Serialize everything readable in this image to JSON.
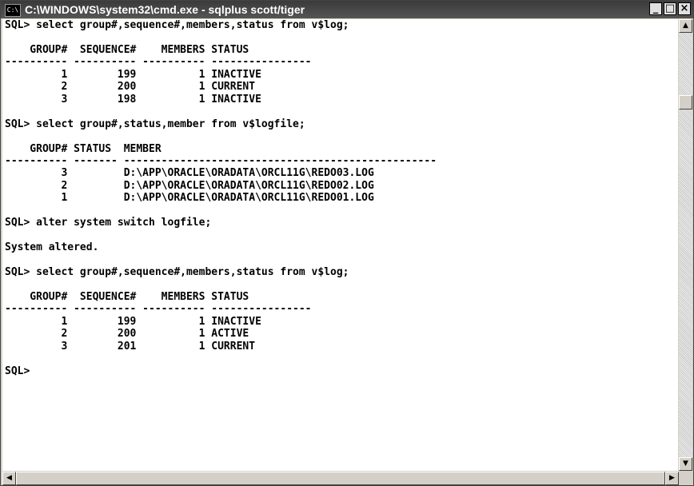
{
  "window": {
    "title": "C:\\WINDOWS\\system32\\cmd.exe - sqlplus scott/tiger",
    "icon": "cmd-icon",
    "buttons": {
      "minimize": "_",
      "maximize": "□",
      "close": "×"
    }
  },
  "console": {
    "lines": [
      "SQL> select group#,sequence#,members,status from v$log;",
      "",
      "    GROUP#  SEQUENCE#    MEMBERS STATUS",
      "---------- ---------- ---------- ----------------",
      "         1        199          1 INACTIVE",
      "         2        200          1 CURRENT",
      "         3        198          1 INACTIVE",
      "",
      "SQL> select group#,status,member from v$logfile;",
      "",
      "    GROUP# STATUS  MEMBER",
      "---------- ------- --------------------------------------------------",
      "         3         D:\\APP\\ORACLE\\ORADATA\\ORCL11G\\REDO03.LOG",
      "         2         D:\\APP\\ORACLE\\ORADATA\\ORCL11G\\REDO02.LOG",
      "         1         D:\\APP\\ORACLE\\ORADATA\\ORCL11G\\REDO01.LOG",
      "",
      "SQL> alter system switch logfile;",
      "",
      "System altered.",
      "",
      "SQL> select group#,sequence#,members,status from v$log;",
      "",
      "    GROUP#  SEQUENCE#    MEMBERS STATUS",
      "---------- ---------- ---------- ----------------",
      "         1        199          1 INACTIVE",
      "         2        200          1 ACTIVE",
      "         3        201          1 CURRENT",
      "",
      "SQL>"
    ]
  },
  "scrollbars": {
    "up": "▲",
    "down": "▼",
    "left": "◀",
    "right": "▶"
  }
}
